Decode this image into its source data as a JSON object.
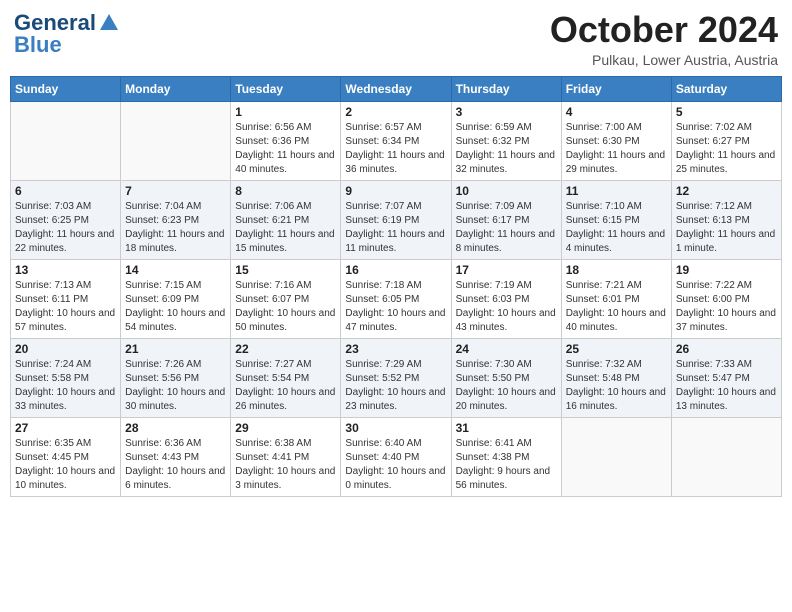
{
  "header": {
    "logo_line1": "General",
    "logo_line2": "Blue",
    "month": "October 2024",
    "location": "Pulkau, Lower Austria, Austria"
  },
  "weekdays": [
    "Sunday",
    "Monday",
    "Tuesday",
    "Wednesday",
    "Thursday",
    "Friday",
    "Saturday"
  ],
  "weeks": [
    [
      {
        "day": "",
        "sunrise": "",
        "sunset": "",
        "daylight": ""
      },
      {
        "day": "",
        "sunrise": "",
        "sunset": "",
        "daylight": ""
      },
      {
        "day": "1",
        "sunrise": "Sunrise: 6:56 AM",
        "sunset": "Sunset: 6:36 PM",
        "daylight": "Daylight: 11 hours and 40 minutes."
      },
      {
        "day": "2",
        "sunrise": "Sunrise: 6:57 AM",
        "sunset": "Sunset: 6:34 PM",
        "daylight": "Daylight: 11 hours and 36 minutes."
      },
      {
        "day": "3",
        "sunrise": "Sunrise: 6:59 AM",
        "sunset": "Sunset: 6:32 PM",
        "daylight": "Daylight: 11 hours and 32 minutes."
      },
      {
        "day": "4",
        "sunrise": "Sunrise: 7:00 AM",
        "sunset": "Sunset: 6:30 PM",
        "daylight": "Daylight: 11 hours and 29 minutes."
      },
      {
        "day": "5",
        "sunrise": "Sunrise: 7:02 AM",
        "sunset": "Sunset: 6:27 PM",
        "daylight": "Daylight: 11 hours and 25 minutes."
      }
    ],
    [
      {
        "day": "6",
        "sunrise": "Sunrise: 7:03 AM",
        "sunset": "Sunset: 6:25 PM",
        "daylight": "Daylight: 11 hours and 22 minutes."
      },
      {
        "day": "7",
        "sunrise": "Sunrise: 7:04 AM",
        "sunset": "Sunset: 6:23 PM",
        "daylight": "Daylight: 11 hours and 18 minutes."
      },
      {
        "day": "8",
        "sunrise": "Sunrise: 7:06 AM",
        "sunset": "Sunset: 6:21 PM",
        "daylight": "Daylight: 11 hours and 15 minutes."
      },
      {
        "day": "9",
        "sunrise": "Sunrise: 7:07 AM",
        "sunset": "Sunset: 6:19 PM",
        "daylight": "Daylight: 11 hours and 11 minutes."
      },
      {
        "day": "10",
        "sunrise": "Sunrise: 7:09 AM",
        "sunset": "Sunset: 6:17 PM",
        "daylight": "Daylight: 11 hours and 8 minutes."
      },
      {
        "day": "11",
        "sunrise": "Sunrise: 7:10 AM",
        "sunset": "Sunset: 6:15 PM",
        "daylight": "Daylight: 11 hours and 4 minutes."
      },
      {
        "day": "12",
        "sunrise": "Sunrise: 7:12 AM",
        "sunset": "Sunset: 6:13 PM",
        "daylight": "Daylight: 11 hours and 1 minute."
      }
    ],
    [
      {
        "day": "13",
        "sunrise": "Sunrise: 7:13 AM",
        "sunset": "Sunset: 6:11 PM",
        "daylight": "Daylight: 10 hours and 57 minutes."
      },
      {
        "day": "14",
        "sunrise": "Sunrise: 7:15 AM",
        "sunset": "Sunset: 6:09 PM",
        "daylight": "Daylight: 10 hours and 54 minutes."
      },
      {
        "day": "15",
        "sunrise": "Sunrise: 7:16 AM",
        "sunset": "Sunset: 6:07 PM",
        "daylight": "Daylight: 10 hours and 50 minutes."
      },
      {
        "day": "16",
        "sunrise": "Sunrise: 7:18 AM",
        "sunset": "Sunset: 6:05 PM",
        "daylight": "Daylight: 10 hours and 47 minutes."
      },
      {
        "day": "17",
        "sunrise": "Sunrise: 7:19 AM",
        "sunset": "Sunset: 6:03 PM",
        "daylight": "Daylight: 10 hours and 43 minutes."
      },
      {
        "day": "18",
        "sunrise": "Sunrise: 7:21 AM",
        "sunset": "Sunset: 6:01 PM",
        "daylight": "Daylight: 10 hours and 40 minutes."
      },
      {
        "day": "19",
        "sunrise": "Sunrise: 7:22 AM",
        "sunset": "Sunset: 6:00 PM",
        "daylight": "Daylight: 10 hours and 37 minutes."
      }
    ],
    [
      {
        "day": "20",
        "sunrise": "Sunrise: 7:24 AM",
        "sunset": "Sunset: 5:58 PM",
        "daylight": "Daylight: 10 hours and 33 minutes."
      },
      {
        "day": "21",
        "sunrise": "Sunrise: 7:26 AM",
        "sunset": "Sunset: 5:56 PM",
        "daylight": "Daylight: 10 hours and 30 minutes."
      },
      {
        "day": "22",
        "sunrise": "Sunrise: 7:27 AM",
        "sunset": "Sunset: 5:54 PM",
        "daylight": "Daylight: 10 hours and 26 minutes."
      },
      {
        "day": "23",
        "sunrise": "Sunrise: 7:29 AM",
        "sunset": "Sunset: 5:52 PM",
        "daylight": "Daylight: 10 hours and 23 minutes."
      },
      {
        "day": "24",
        "sunrise": "Sunrise: 7:30 AM",
        "sunset": "Sunset: 5:50 PM",
        "daylight": "Daylight: 10 hours and 20 minutes."
      },
      {
        "day": "25",
        "sunrise": "Sunrise: 7:32 AM",
        "sunset": "Sunset: 5:48 PM",
        "daylight": "Daylight: 10 hours and 16 minutes."
      },
      {
        "day": "26",
        "sunrise": "Sunrise: 7:33 AM",
        "sunset": "Sunset: 5:47 PM",
        "daylight": "Daylight: 10 hours and 13 minutes."
      }
    ],
    [
      {
        "day": "27",
        "sunrise": "Sunrise: 6:35 AM",
        "sunset": "Sunset: 4:45 PM",
        "daylight": "Daylight: 10 hours and 10 minutes."
      },
      {
        "day": "28",
        "sunrise": "Sunrise: 6:36 AM",
        "sunset": "Sunset: 4:43 PM",
        "daylight": "Daylight: 10 hours and 6 minutes."
      },
      {
        "day": "29",
        "sunrise": "Sunrise: 6:38 AM",
        "sunset": "Sunset: 4:41 PM",
        "daylight": "Daylight: 10 hours and 3 minutes."
      },
      {
        "day": "30",
        "sunrise": "Sunrise: 6:40 AM",
        "sunset": "Sunset: 4:40 PM",
        "daylight": "Daylight: 10 hours and 0 minutes."
      },
      {
        "day": "31",
        "sunrise": "Sunrise: 6:41 AM",
        "sunset": "Sunset: 4:38 PM",
        "daylight": "Daylight: 9 hours and 56 minutes."
      },
      {
        "day": "",
        "sunrise": "",
        "sunset": "",
        "daylight": ""
      },
      {
        "day": "",
        "sunrise": "",
        "sunset": "",
        "daylight": ""
      }
    ]
  ]
}
